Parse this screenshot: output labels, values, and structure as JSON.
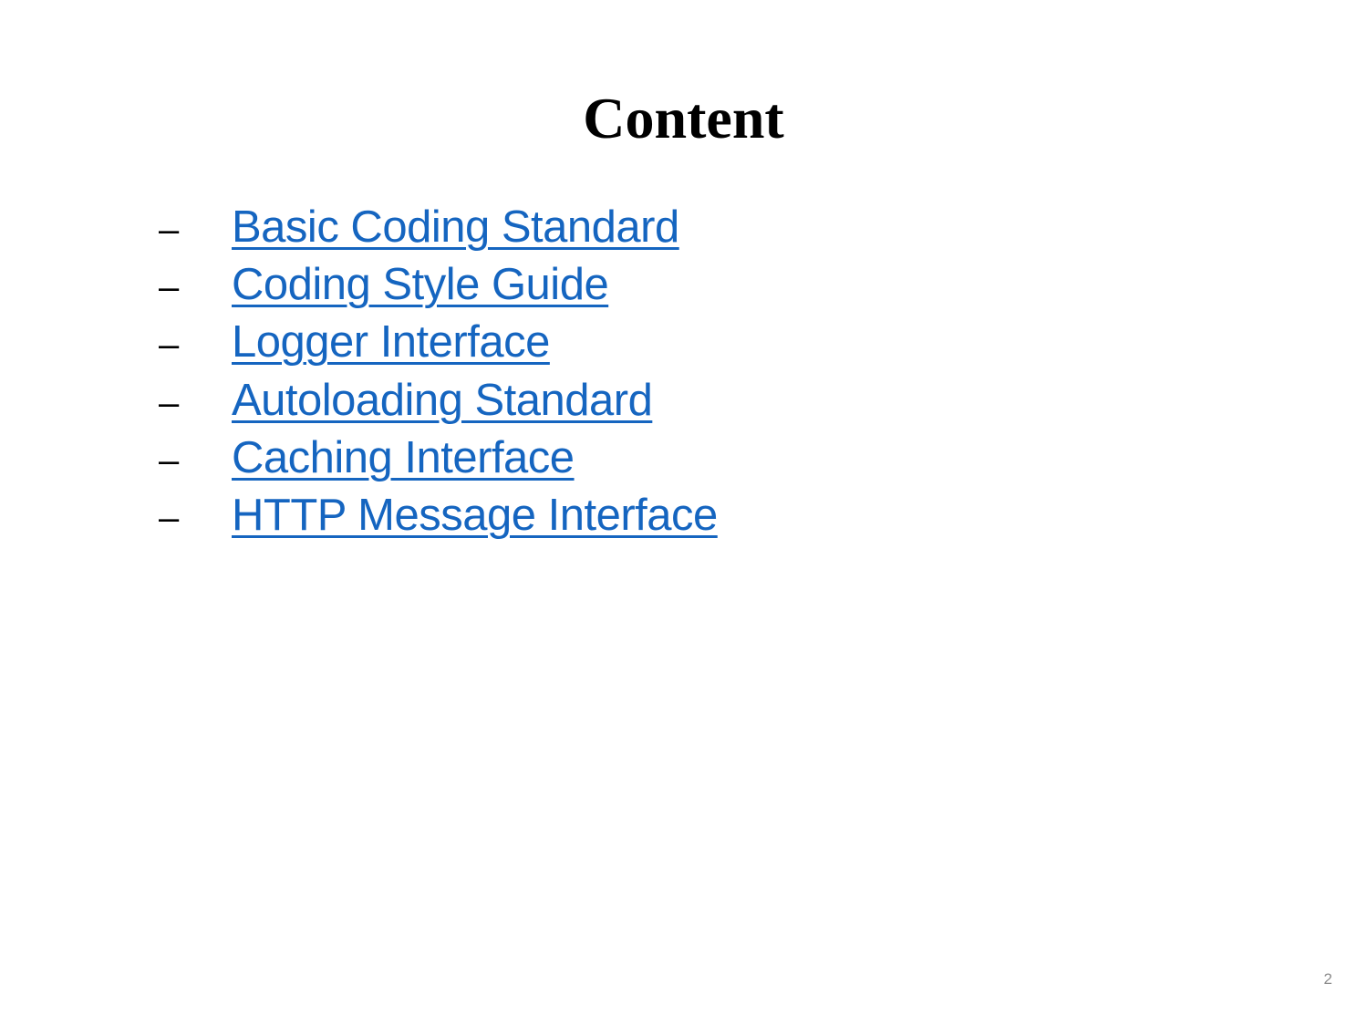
{
  "slide": {
    "title": "Content",
    "items": [
      {
        "bullet": "–",
        "label": "Basic Coding Standard"
      },
      {
        "bullet": "–",
        "label": "Coding Style Guide"
      },
      {
        "bullet": "–",
        "label": "Logger Interface"
      },
      {
        "bullet": "–",
        "label": "Autoloading Standard"
      },
      {
        "bullet": "–",
        "label": "Caching Interface"
      },
      {
        "bullet": "–",
        "label": "HTTP Message Interface"
      }
    ],
    "page_number": "2",
    "colors": {
      "link": "#1565c0",
      "title": "#000000",
      "page_number": "#8c8c8c"
    }
  }
}
